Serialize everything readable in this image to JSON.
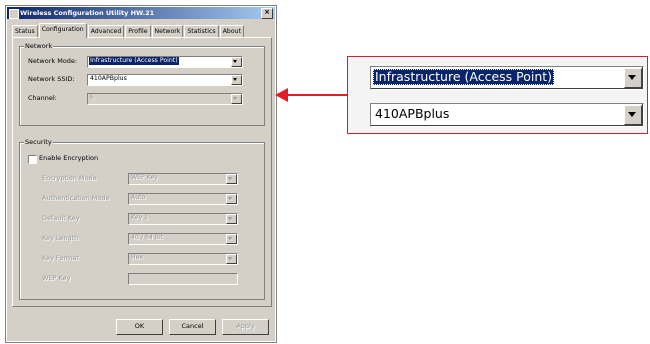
{
  "window": {
    "title": "Wireless Configuration Utility HW.21",
    "close_glyph": "×"
  },
  "tabs": [
    {
      "label": "Status"
    },
    {
      "label": "Configuration"
    },
    {
      "label": "Advanced"
    },
    {
      "label": "Profile"
    },
    {
      "label": "Network"
    },
    {
      "label": "Statistics"
    },
    {
      "label": "About"
    }
  ],
  "active_tab": "Configuration",
  "network": {
    "group_label": "Network",
    "mode_label": "Network Mode:",
    "mode_value": "Infrastructure (Access Point)",
    "ssid_label": "Network SSID:",
    "ssid_value": "410APBplus",
    "channel_label": "Channel:",
    "channel_value": "6"
  },
  "security": {
    "group_label": "Security",
    "enable_label": "Enable Encryption",
    "fields": [
      {
        "label": "Encryption Mode",
        "value": "WEP Key"
      },
      {
        "label": "Authentication Mode",
        "value": "Auto"
      },
      {
        "label": "Default Key",
        "value": "Key 1"
      },
      {
        "label": "Key Length",
        "value": "40 / 64 Bit"
      },
      {
        "label": "Key Format",
        "value": "Hex"
      },
      {
        "label": "WEP Key",
        "value": ""
      }
    ]
  },
  "buttons": {
    "ok": "OK",
    "cancel": "Cancel",
    "apply": "Apply"
  },
  "zoom": {
    "mode_value": "Infrastructure (Access Point)",
    "ssid_value": "410APBplus"
  },
  "colors": {
    "callout": "#e01e28",
    "selection": "#0a246a",
    "face": "#d4d0c8"
  }
}
